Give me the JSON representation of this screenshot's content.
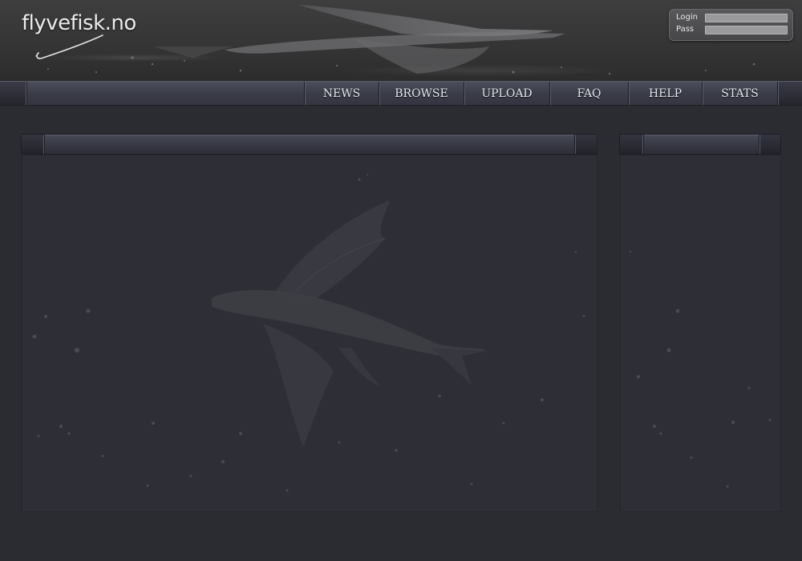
{
  "site": {
    "logo_text": "flyvefisk.no"
  },
  "login": {
    "login_label": "Login",
    "pass_label": "Pass",
    "login_value": "",
    "pass_value": ""
  },
  "nav": {
    "items": [
      {
        "label": "NEWS"
      },
      {
        "label": "BROWSE"
      },
      {
        "label": "UPLOAD"
      },
      {
        "label": "FAQ"
      },
      {
        "label": "HELP"
      },
      {
        "label": "STATS"
      }
    ]
  },
  "panels": {
    "main_title": "",
    "side_title": ""
  },
  "colors": {
    "page_bg": "#2b2c32",
    "nav_text": "#e6e8ef",
    "panel_bg": "#2e2f36"
  },
  "icons": [
    "fishing-hook-icon",
    "flying-fish-banner",
    "flying-fish-background"
  ]
}
